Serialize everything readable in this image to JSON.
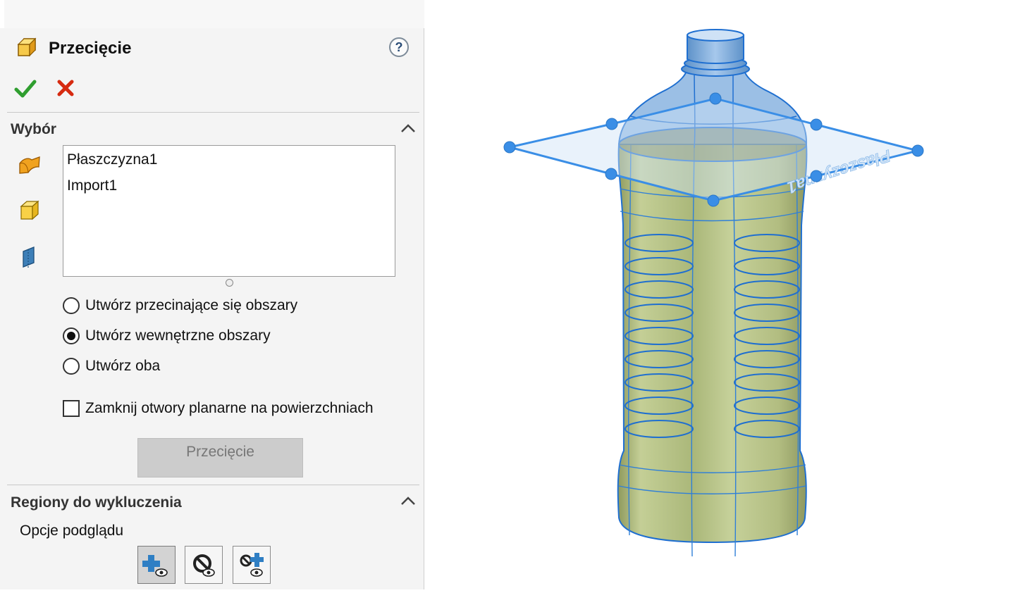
{
  "property_manager": {
    "title": "Przecięcie",
    "help_label": "?",
    "ok_icon": "checkmark-icon",
    "cancel_icon": "x-icon"
  },
  "selection": {
    "header": "Wybór",
    "items": [
      "Płaszczyzna1",
      "Import1"
    ],
    "options": [
      {
        "label": "Utwórz przecinające się obszary",
        "selected": false
      },
      {
        "label": "Utwórz wewnętrzne obszary",
        "selected": true
      },
      {
        "label": "Utwórz oba",
        "selected": false
      }
    ],
    "close_holes_label": "Zamknij otwory planarne na powierzchniach",
    "close_holes_checked": false,
    "intersect_button_label": "Przecięcie"
  },
  "exclusion": {
    "header": "Regiony do wykluczenia",
    "preview_label": "Opcje podglądu"
  },
  "viewport": {
    "plane_label": "Płaszczyzna1",
    "accent_color": "#3a8ee6",
    "body_color": "#b7c48a"
  }
}
